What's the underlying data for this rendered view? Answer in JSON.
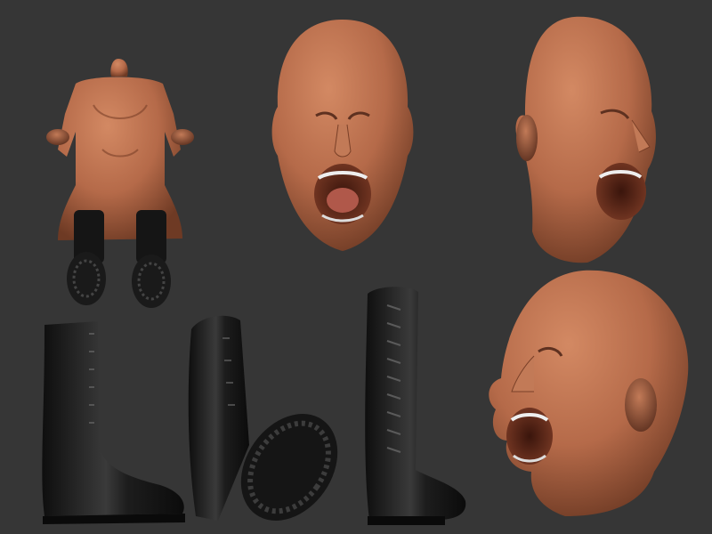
{
  "scene": {
    "background_color": "#363636",
    "clay_color": "#b56a49",
    "boot_color": "#1c1c1c"
  },
  "renders": [
    {
      "name": "seated-body",
      "material": "clay"
    },
    {
      "name": "head-front",
      "material": "clay"
    },
    {
      "name": "head-three-quarter",
      "material": "clay"
    },
    {
      "name": "boot-side",
      "material": "black"
    },
    {
      "name": "boot-sole-view",
      "material": "black"
    },
    {
      "name": "boot-front",
      "material": "black"
    },
    {
      "name": "head-profile",
      "material": "clay"
    }
  ]
}
